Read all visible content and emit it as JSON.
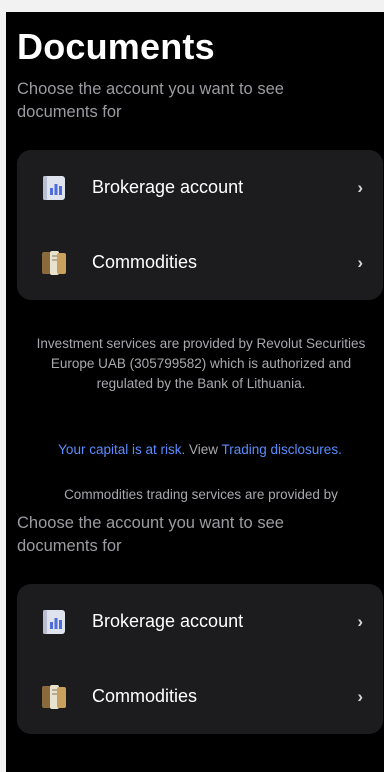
{
  "page": {
    "title": "Documents",
    "subtitle": "Choose the account you want to see documents for"
  },
  "accounts": [
    {
      "label": "Brokerage account",
      "icon": "chart-book-icon"
    },
    {
      "label": "Commodities",
      "icon": "gold-book-icon"
    }
  ],
  "disclosure": {
    "investment_text": "Investment services are provided by Revolut Securities Europe UAB (305799582) which is authorized and regulated by the Bank of Lithuania.",
    "risk_link": "Your capital is at risk.",
    "view_text": " View ",
    "trading_link": "Trading disclosures.",
    "commodities_text": "Commodities trading services are provided by"
  },
  "colors": {
    "background": "#000000",
    "card": "#1c1c1e",
    "text_secondary": "#9b9ba1",
    "link": "#5a8dff"
  }
}
